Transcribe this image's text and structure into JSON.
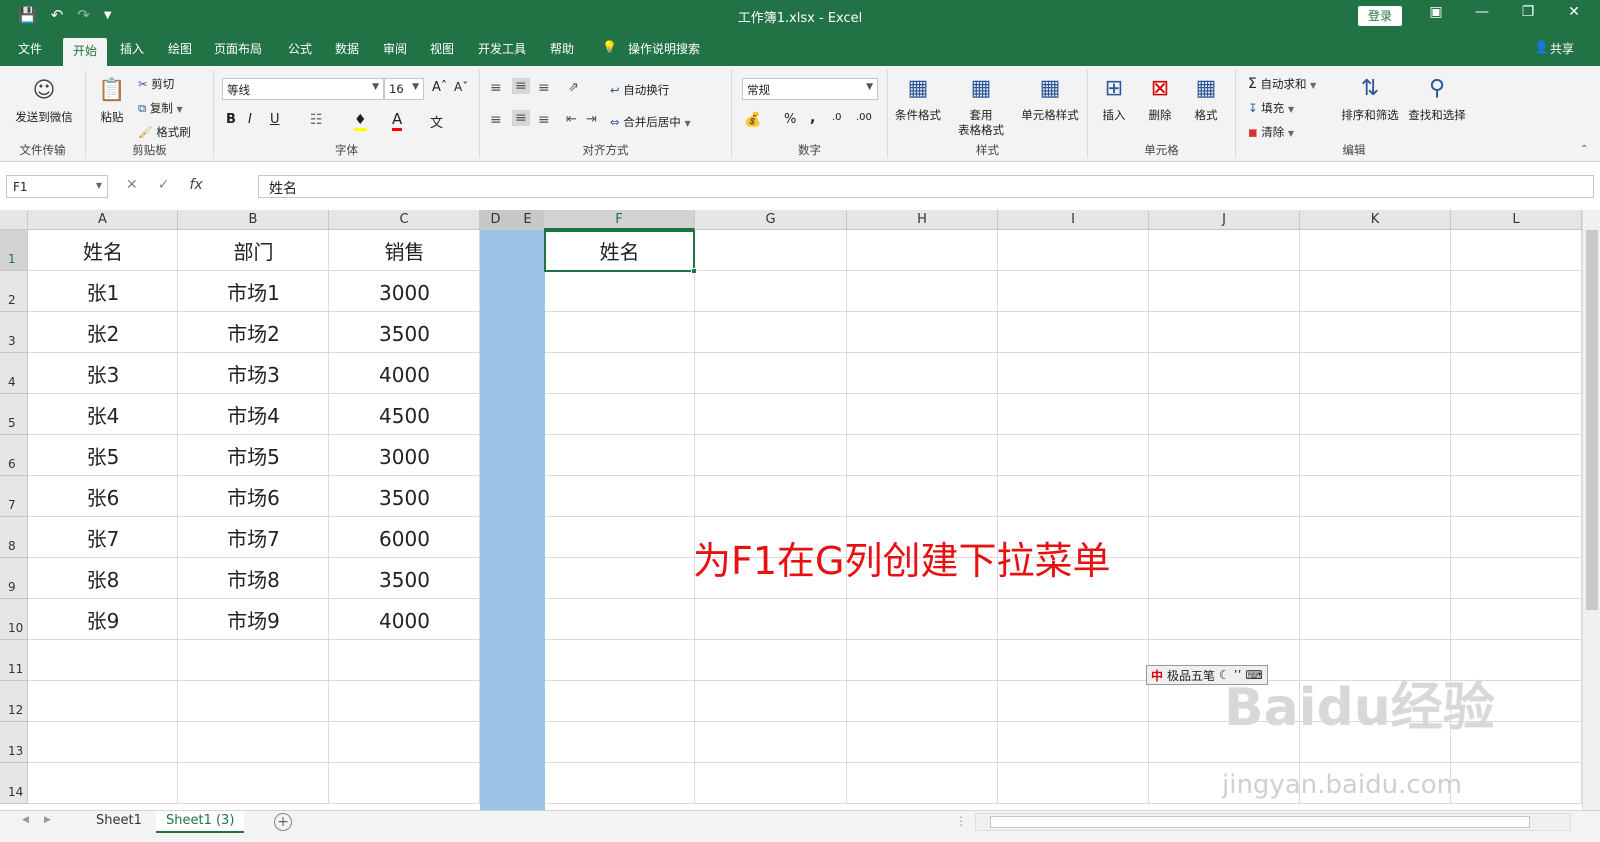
{
  "titlebar": {
    "doc_title": "工作簿1.xlsx  -  Excel",
    "login": "登录",
    "qat_icons": [
      "save-icon",
      "undo-icon",
      "redo-icon",
      "customize-icon"
    ]
  },
  "tabs": [
    "文件",
    "开始",
    "插入",
    "绘图",
    "页面布局",
    "公式",
    "数据",
    "审阅",
    "视图",
    "开发工具",
    "帮助"
  ],
  "active_tab": "开始",
  "tell_me": "操作说明搜索",
  "share": "共享",
  "ribbon": {
    "file_transfer": {
      "button": "发送到微信",
      "group": "文件传输"
    },
    "clipboard": {
      "paste": "粘贴",
      "cut": "剪切",
      "copy": "复制",
      "format_painter": "格式刷",
      "group": "剪贴板"
    },
    "font": {
      "name": "等线",
      "size": "16",
      "bold": "B",
      "italic": "I",
      "underline": "U",
      "group": "字体",
      "font_color": "#ff0000",
      "fill_color": "#ffff00"
    },
    "alignment": {
      "wrap": "自动换行",
      "merge": "合并后居中",
      "group": "对齐方式"
    },
    "number": {
      "format": "常规",
      "percent": "%",
      "comma": ",",
      "group": "数字"
    },
    "styles": {
      "conditional": "条件格式",
      "table_l1": "套用",
      "table_l2": "表格格式",
      "cell_styles": "单元格样式",
      "group": "样式"
    },
    "cells": {
      "insert": "插入",
      "delete": "删除",
      "format": "格式",
      "group": "单元格"
    },
    "editing": {
      "autosum": "自动求和",
      "fill": "填充",
      "clear": "清除",
      "sort": "排序和筛选",
      "find": "查找和选择",
      "group": "编辑"
    }
  },
  "formula_bar": {
    "name_box": "F1",
    "fx": "fx",
    "content": "姓名"
  },
  "columns": [
    "A",
    "B",
    "C",
    "D",
    "E",
    "F",
    "G",
    "H",
    "I",
    "J",
    "K",
    "L"
  ],
  "rows": [
    "1",
    "2",
    "3",
    "4",
    "5",
    "6",
    "7",
    "8",
    "9",
    "10",
    "11",
    "12",
    "13",
    "14"
  ],
  "table": {
    "headers": [
      "姓名",
      "部门",
      "销售"
    ],
    "rows": [
      [
        "张1",
        "市场1",
        "3000"
      ],
      [
        "张2",
        "市场2",
        "3500"
      ],
      [
        "张3",
        "市场3",
        "4000"
      ],
      [
        "张4",
        "市场4",
        "4500"
      ],
      [
        "张5",
        "市场5",
        "3000"
      ],
      [
        "张6",
        "市场6",
        "3500"
      ],
      [
        "张7",
        "市场7",
        "6000"
      ],
      [
        "张8",
        "市场8",
        "3500"
      ],
      [
        "张9",
        "市场9",
        "4000"
      ]
    ]
  },
  "f1_value": "姓名",
  "annotation": "为F1在G列创建下拉菜单",
  "ime": {
    "label": "极品五笔",
    "glyph": "中"
  },
  "watermark": {
    "logo": "Baidu经验",
    "url": "jingyan.baidu.com"
  },
  "sheets": [
    "Sheet1",
    "Sheet1 (3)"
  ],
  "active_sheet": "Sheet1 (3)",
  "colors": {
    "excel_green": "#217346",
    "selection_blue": "#9dc3e6",
    "annotation_red": "#e81010"
  }
}
